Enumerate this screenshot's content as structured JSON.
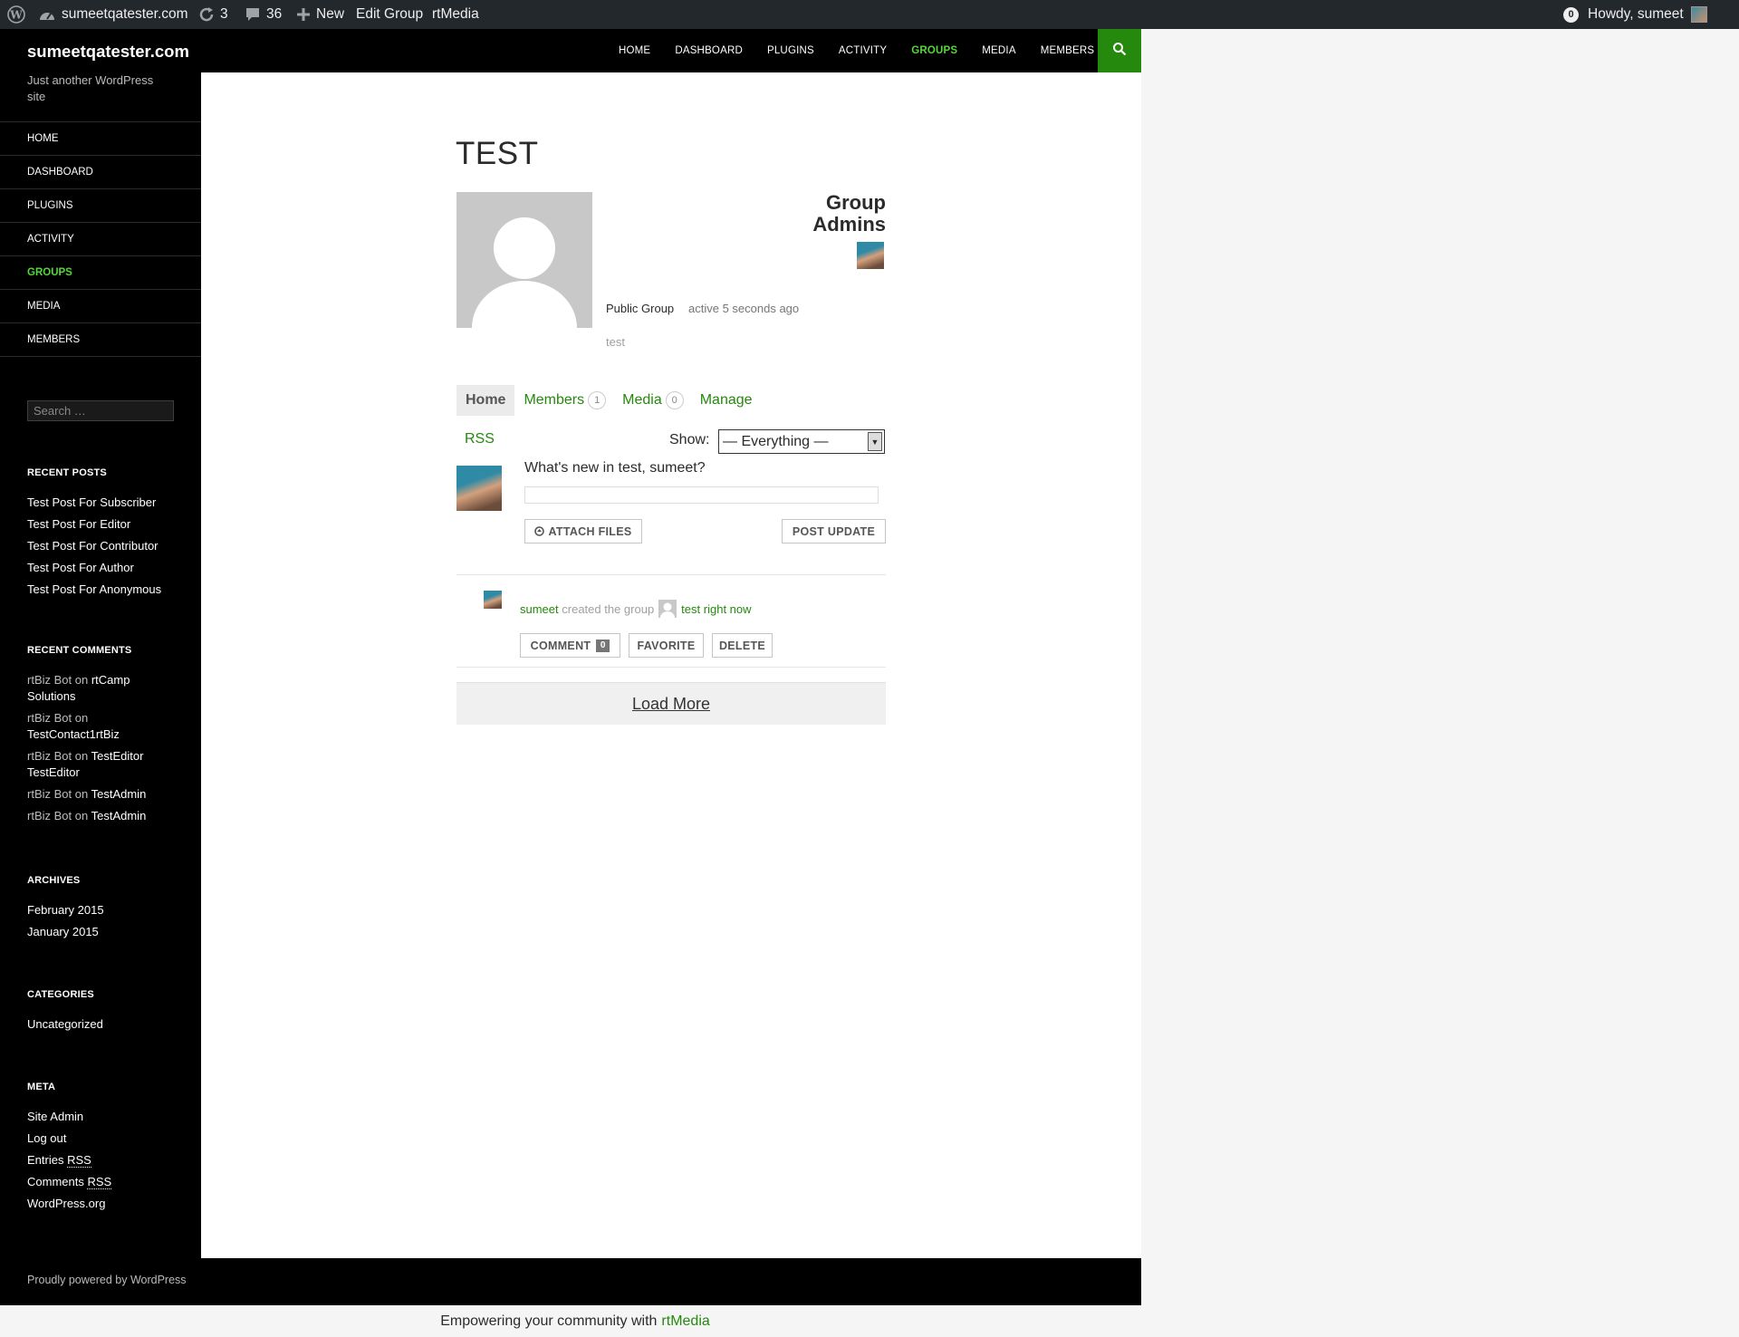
{
  "adminbar": {
    "site": "sumeetqatester.com",
    "updates": "3",
    "comments": "36",
    "new_label": "New",
    "edit_group": "Edit Group",
    "rtmedia": "rtMedia",
    "notifications": "0",
    "howdy": "Howdy, sumeet"
  },
  "header": {
    "site_title": "sumeetqatester.com",
    "nav": [
      "HOME",
      "DASHBOARD",
      "PLUGINS",
      "ACTIVITY",
      "GROUPS",
      "MEDIA",
      "MEMBERS"
    ],
    "current": "GROUPS"
  },
  "sidebar": {
    "tagline": "Just another WordPress site",
    "nav": [
      "HOME",
      "DASHBOARD",
      "PLUGINS",
      "ACTIVITY",
      "GROUPS",
      "MEDIA",
      "MEMBERS"
    ],
    "search_placeholder": "Search …",
    "recent_posts": {
      "title": "RECENT POSTS",
      "items": [
        "Test Post For Subscriber",
        "Test Post For Editor",
        "Test Post For Contributor",
        "Test Post For Author",
        "Test Post For Anonymous"
      ]
    },
    "recent_comments": {
      "title": "RECENT COMMENTS",
      "items": [
        {
          "author": "rtBiz Bot",
          "on": "on",
          "post": "rtCamp Solutions"
        },
        {
          "author": "rtBiz Bot",
          "on": "on",
          "post": "TestContact1rtBiz"
        },
        {
          "author": "rtBiz Bot",
          "on": "on",
          "post": "TestEditor TestEditor"
        },
        {
          "author": "rtBiz Bot",
          "on": "on",
          "post": "TestAdmin"
        },
        {
          "author": "rtBiz Bot",
          "on": "on",
          "post": "TestAdmin"
        }
      ]
    },
    "archives": {
      "title": "ARCHIVES",
      "items": [
        "February 2015",
        "January 2015"
      ]
    },
    "categories": {
      "title": "CATEGORIES",
      "items": [
        "Uncategorized"
      ]
    },
    "meta": {
      "title": "META",
      "site_admin": "Site Admin",
      "log_out": "Log out",
      "entries": "Entries",
      "comments": "Comments",
      "rss": "RSS",
      "wordpress_org": "WordPress.org"
    }
  },
  "group": {
    "title": "TEST",
    "admins_title": "Group Admins",
    "type": "Public Group",
    "activity": "active 5 seconds ago",
    "description": "test",
    "tabs": [
      {
        "label": "Home"
      },
      {
        "label": "Members",
        "count": "1"
      },
      {
        "label": "Media",
        "count": "0"
      },
      {
        "label": "Manage"
      }
    ],
    "rss": "RSS",
    "show_label": "Show:",
    "filter_value": "— Everything —",
    "whats_new": "What's new in test, sumeet?",
    "attach_files": "ATTACH FILES",
    "post_update": "POST UPDATE",
    "activity_item": {
      "user": "sumeet",
      "action": "created the group",
      "group": "test",
      "time": "right now",
      "comment": "COMMENT",
      "comment_count": "0",
      "favorite": "FAVORITE",
      "delete": "DELETE"
    },
    "load_more": "Load More"
  },
  "footer": {
    "powered": "Proudly powered by WordPress",
    "rtmedia_text": "Empowering your community with",
    "rtmedia_link": "rtMedia"
  },
  "colors": {
    "accent": "#24890d",
    "accent_light": "#55d737",
    "admin_bar": "#23282d"
  }
}
